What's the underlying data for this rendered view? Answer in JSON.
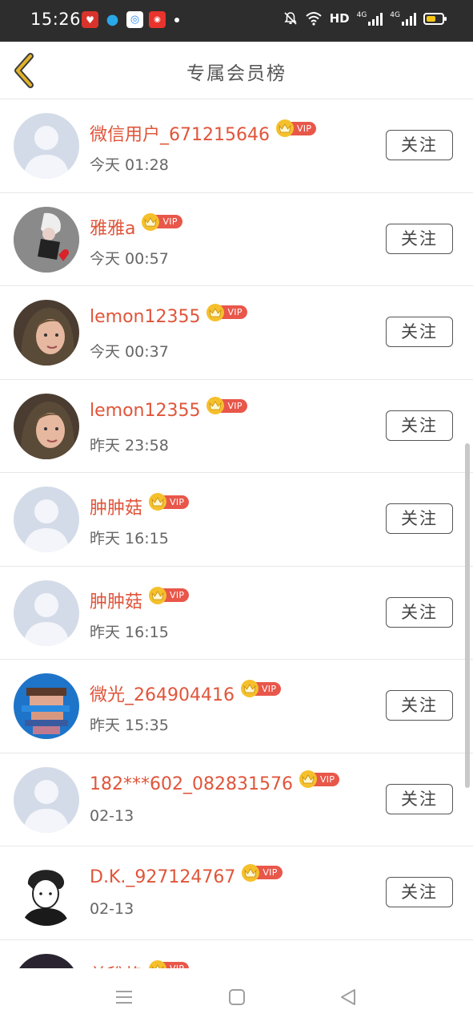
{
  "status_bar": {
    "time": "15:26",
    "network_label": "HD",
    "sig1_label": "4G",
    "sig2_label": "4G",
    "icons": [
      "netease-music-icon",
      "qq-icon",
      "browser-icon",
      "news-icon",
      "notification-dot",
      "bell-muted-icon",
      "wifi-icon",
      "signal-icon",
      "battery-icon"
    ]
  },
  "header": {
    "title": "专属会员榜",
    "back_icon": "chevron-left-icon"
  },
  "list": {
    "vip_label": "VIP",
    "follow_label": "关注",
    "items": [
      {
        "name": "微信用户_671215646",
        "time": "今天 01:28",
        "avatar": "default"
      },
      {
        "name": "雅雅a",
        "time": "今天 00:57",
        "avatar": "photo-gray"
      },
      {
        "name": "lemon12355",
        "time": "今天 00:37",
        "avatar": "photo-person"
      },
      {
        "name": "lemon12355",
        "time": "昨天 23:58",
        "avatar": "photo-person"
      },
      {
        "name": "肿肿菇",
        "time": "昨天 16:15",
        "avatar": "default"
      },
      {
        "name": "肿肿菇",
        "time": "昨天 16:15",
        "avatar": "default"
      },
      {
        "name": "微光_264904416",
        "time": "昨天 15:35",
        "avatar": "photo-blue"
      },
      {
        "name": "182***602_082831576",
        "time": "02-13",
        "avatar": "default"
      },
      {
        "name": "D.K._927124767",
        "time": "02-13",
        "avatar": "photo-sketch"
      },
      {
        "name": "美稚格",
        "time": "",
        "avatar": "photo-dark"
      }
    ]
  },
  "colors": {
    "name": "#e0553a",
    "vip_pill": "#e8574a",
    "crown": "#f5c02b",
    "back_arrow": "#e0b22a"
  },
  "nav": {
    "buttons": [
      "menu-icon",
      "home-square-icon",
      "back-triangle-icon"
    ]
  }
}
